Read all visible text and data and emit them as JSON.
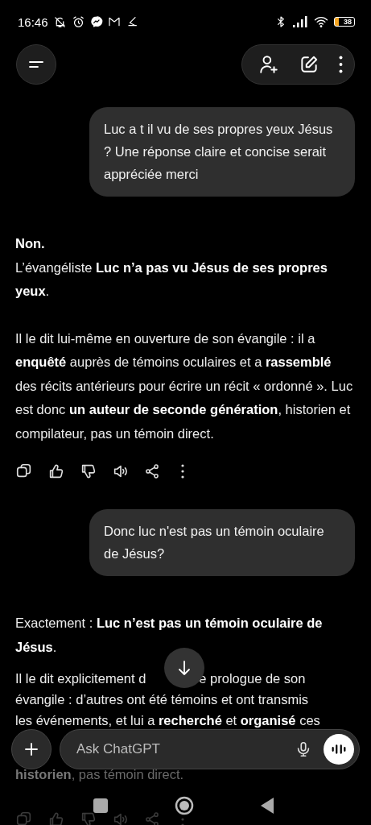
{
  "status_bar": {
    "time": "16:46",
    "battery": "38"
  },
  "messages": [
    {
      "kind": "user",
      "text": "Luc a t il vu de ses propres yeux Jésus ? Une réponse claire et concise serait appréciée merci"
    },
    {
      "kind": "assistant",
      "paragraphs": [
        "**Non.**\nL’évangéliste **Luc n’a pas vu Jésus de ses propres yeux**.",
        "Il le dit lui-même en ouverture de son évangile : il a **enquêté** auprès de témoins oculaires et a **rassemblé** des récits antérieurs pour écrire un récit « ordonné ». Luc est donc **un auteur de seconde génération**, historien et compilateur, pas un témoin direct."
      ]
    },
    {
      "kind": "user",
      "text": "Donc luc n'est pas un témoin oculaire de Jésus?"
    },
    {
      "kind": "assistant",
      "paragraphs": [
        "Exactement : **Luc n’est pas un témoin oculaire de Jésus**."
      ],
      "lines": [
        [
          "Il le dit explicitement d",
          "e prologue de son"
        ],
        [
          "évangile : d’autres ont été témoins et ont transmis"
        ],
        [
          "les événements, et lui a **recherché** et **organisé** ces"
        ]
      ],
      "faded": [
        "**historien**, pas témoin direct."
      ]
    }
  ],
  "composer": {
    "placeholder": "Ask ChatGPT"
  }
}
